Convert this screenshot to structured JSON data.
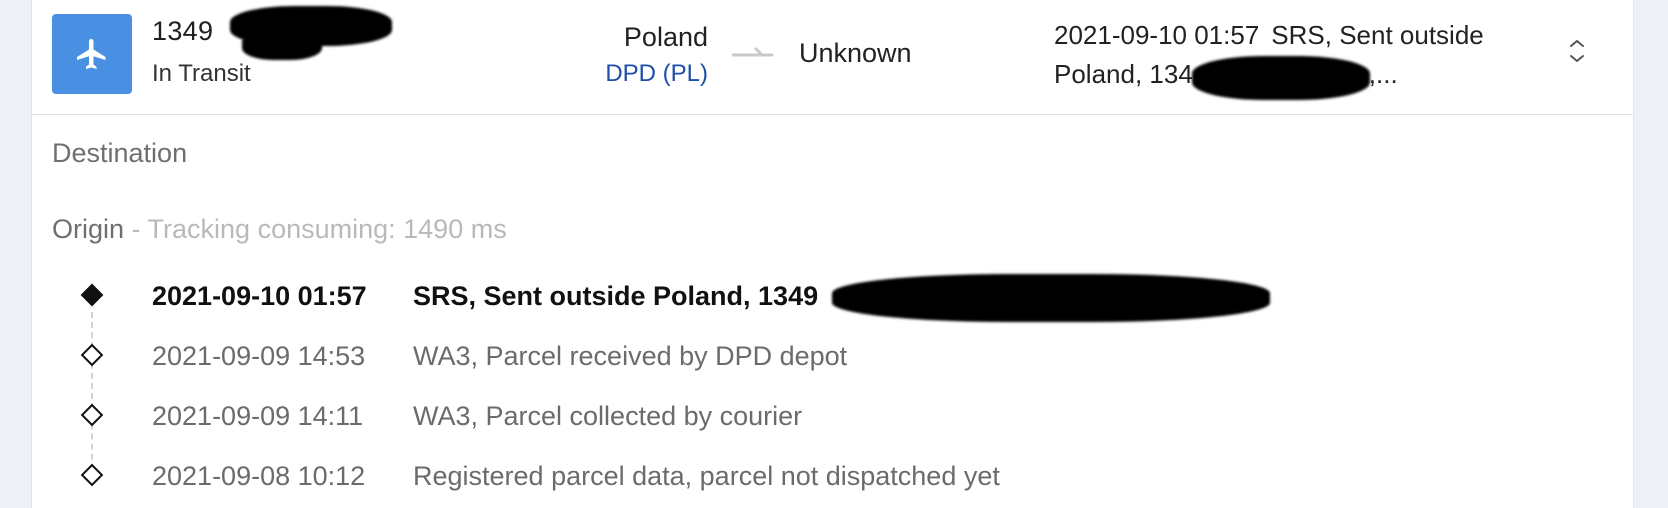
{
  "shipment": {
    "icon": "airplane-icon",
    "tracking_number_visible": "1349",
    "status": "In Transit",
    "origin_country": "Poland",
    "carrier": "DPD (PL)",
    "destination_country": "Unknown",
    "latest_event": {
      "time": "2021-09-10 01:57",
      "line1_text": "SRS, Sent outside",
      "line2_prefix": "Poland, 134",
      "line2_suffix": ",..."
    }
  },
  "colors": {
    "accent": "#4a90e2",
    "carrier_link": "#1e4ea8",
    "page_background": "#eef0f8"
  },
  "details": {
    "destination_label": "Destination",
    "origin_label": "Origin",
    "origin_separator": " - ",
    "tracking_consuming": "Tracking consuming: 1490 ms"
  },
  "events": [
    {
      "time": "2021-09-10 01:57",
      "description": "SRS, Sent outside Poland, 1349"
    },
    {
      "time": "2021-09-09 14:53",
      "description": "WA3, Parcel received by DPD depot"
    },
    {
      "time": "2021-09-09 14:11",
      "description": "WA3, Parcel collected by courier"
    },
    {
      "time": "2021-09-08 10:12",
      "description": "Registered parcel data, parcel not dispatched yet"
    }
  ]
}
